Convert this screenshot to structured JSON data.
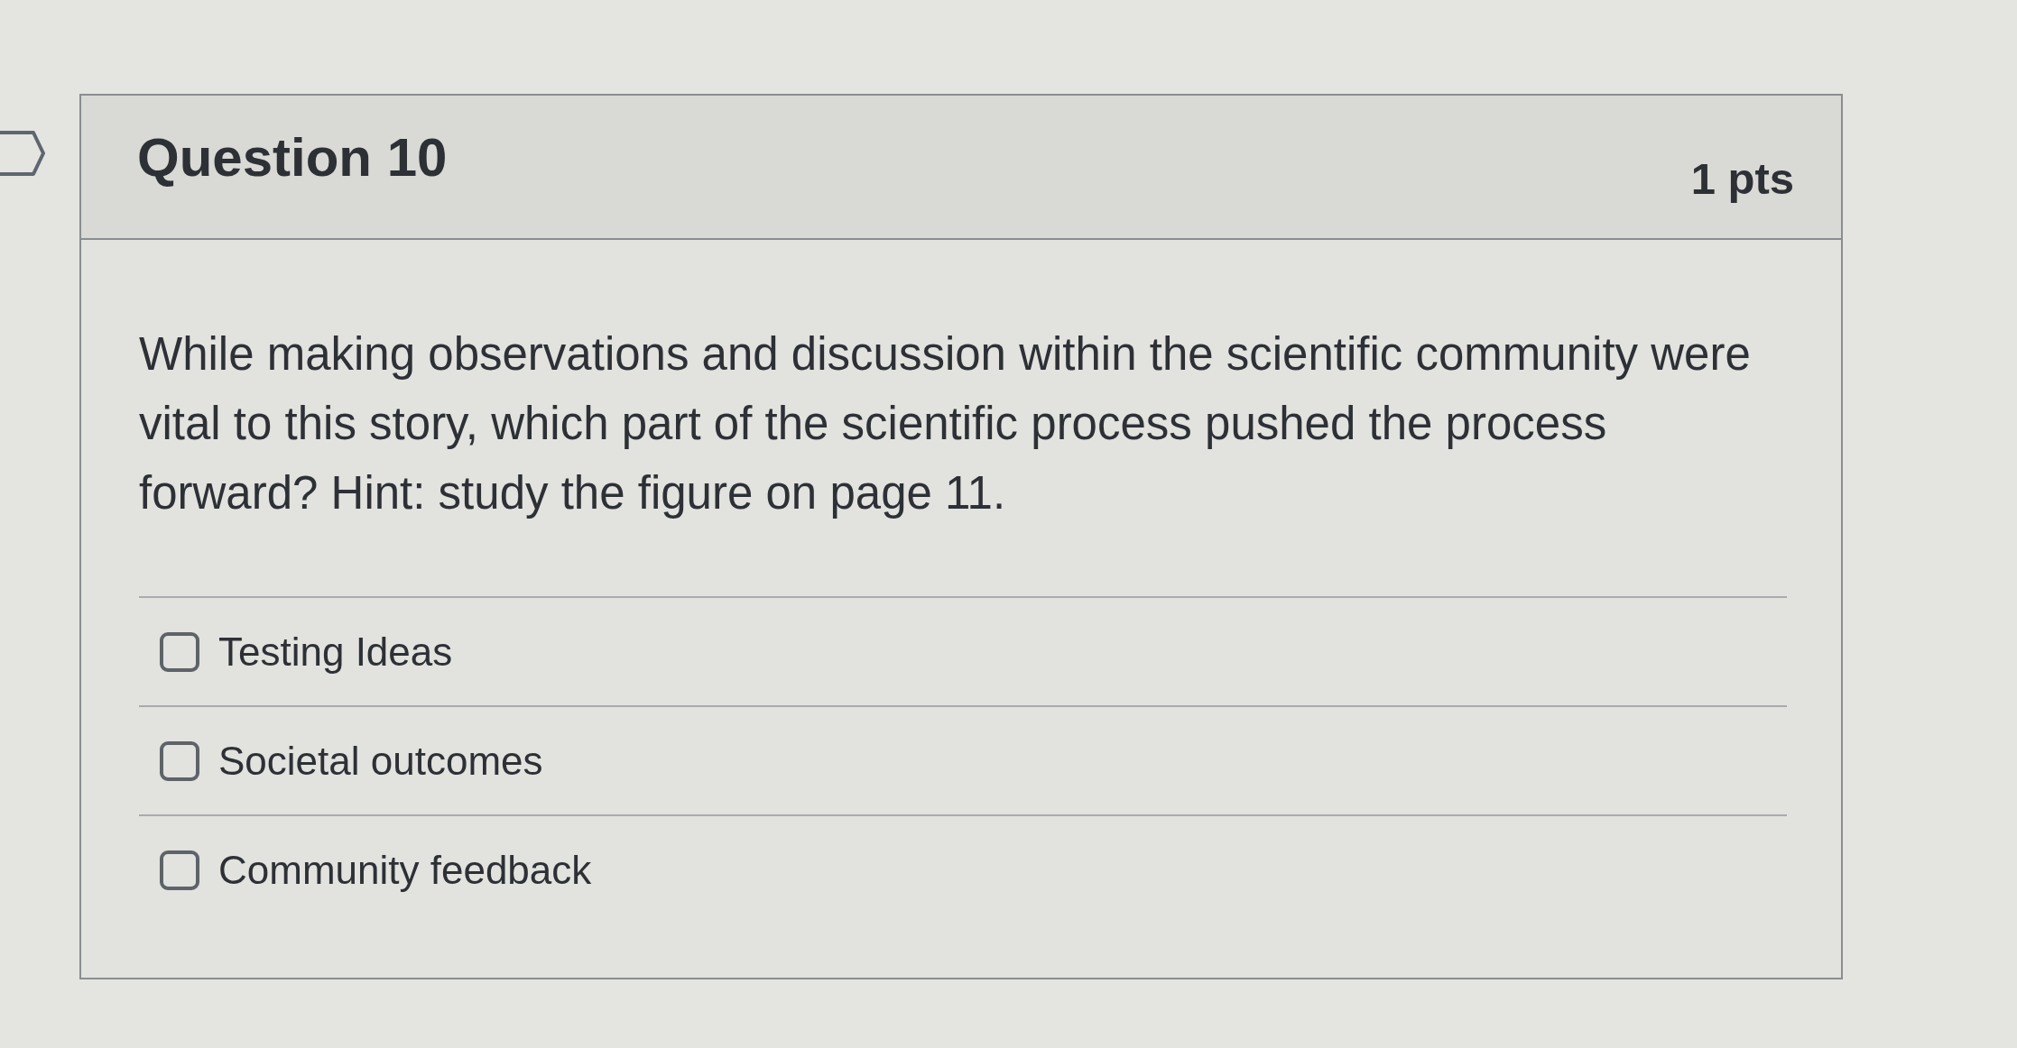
{
  "question": {
    "flagged": false,
    "title": "Question 10",
    "points": "1 pts",
    "text": "While making observations and discussion within the scientific community were vital to this story, which part of the scientific process pushed the process forward? Hint: study the figure on page 11.",
    "options": [
      {
        "label": "Testing Ideas",
        "checked": false
      },
      {
        "label": "Societal outcomes",
        "checked": false
      },
      {
        "label": "Community feedback",
        "checked": false
      }
    ]
  }
}
